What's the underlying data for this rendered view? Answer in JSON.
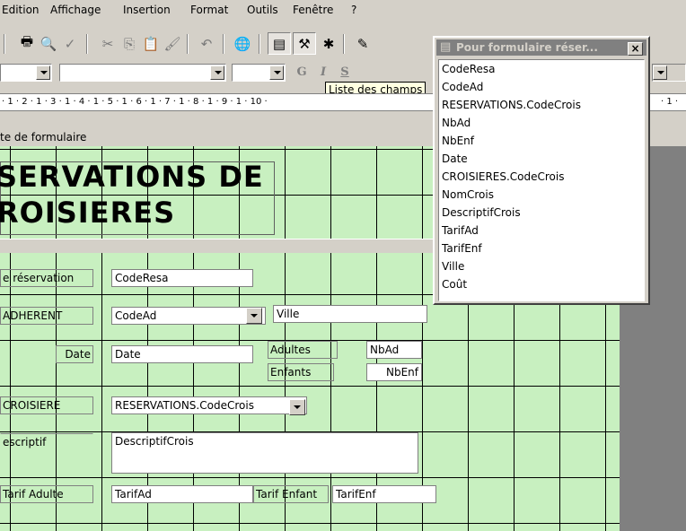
{
  "menu": [
    "Edition",
    "Affichage",
    "Insertion",
    "Format",
    "Outils",
    "Fenêtre",
    "?"
  ],
  "toolbar_icons": [
    "print-icon",
    "print-preview-icon",
    "spelling-icon",
    "cut-icon",
    "copy-icon",
    "paste-icon",
    "format-painter-icon",
    "undo-icon",
    "insert-hyperlink-icon",
    "field-list-icon",
    "toolbox-icon",
    "autoformat-icon",
    "code-icon"
  ],
  "format_bar": {
    "bold": "G",
    "italic": "I",
    "underline": "S"
  },
  "tooltip": "Liste des champs",
  "ruler_text": "· 1 · 2 · 1 · 3 · 1 · 4 · 1 · 5 · 1 · 6 · 1 · 7 · 1 · 8 · 1 · 9 · 1 · 10 ·",
  "ruler_right": "· 1 ·",
  "form_header_label": "te de formulaire",
  "title_line1": "SERVATIONS DE",
  "title_line2": "ROISIERES",
  "field_list": {
    "title": "Pour formulaire réser...",
    "close": "×",
    "items": [
      "CodeResa",
      "CodeAd",
      "RESERVATIONS.CodeCrois",
      "NbAd",
      "NbEnf",
      "Date",
      "CROISIERES.CodeCrois",
      "NomCrois",
      "DescriptifCrois",
      "TarifAd",
      "TarifEnf",
      "Ville",
      "Coût"
    ]
  },
  "controls": {
    "lbl_reservation": "e réservation",
    "txt_coderesa": "CodeResa",
    "lbl_adherent": "ADHERENT",
    "txt_codead": "CodeAd",
    "txt_ville": "Ville",
    "lbl_date": "Date",
    "txt_date": "Date",
    "lbl_adultes": "Adultes",
    "txt_nbad": "NbAd",
    "lbl_enfants": "Enfants",
    "txt_nbenf": "NbEnf",
    "lbl_croisiere": "CROISIERE",
    "txt_codecrois": "RESERVATIONS.CodeCrois",
    "lbl_descriptif": "escriptif",
    "txt_descriptif": "DescriptifCrois",
    "lbl_tarif_adulte": "Tarif Adulte",
    "txt_tarifad": "TarifAd",
    "lbl_tarif_enfant": "Tarif Enfant",
    "txt_tarifenf": "TarifEnf"
  }
}
